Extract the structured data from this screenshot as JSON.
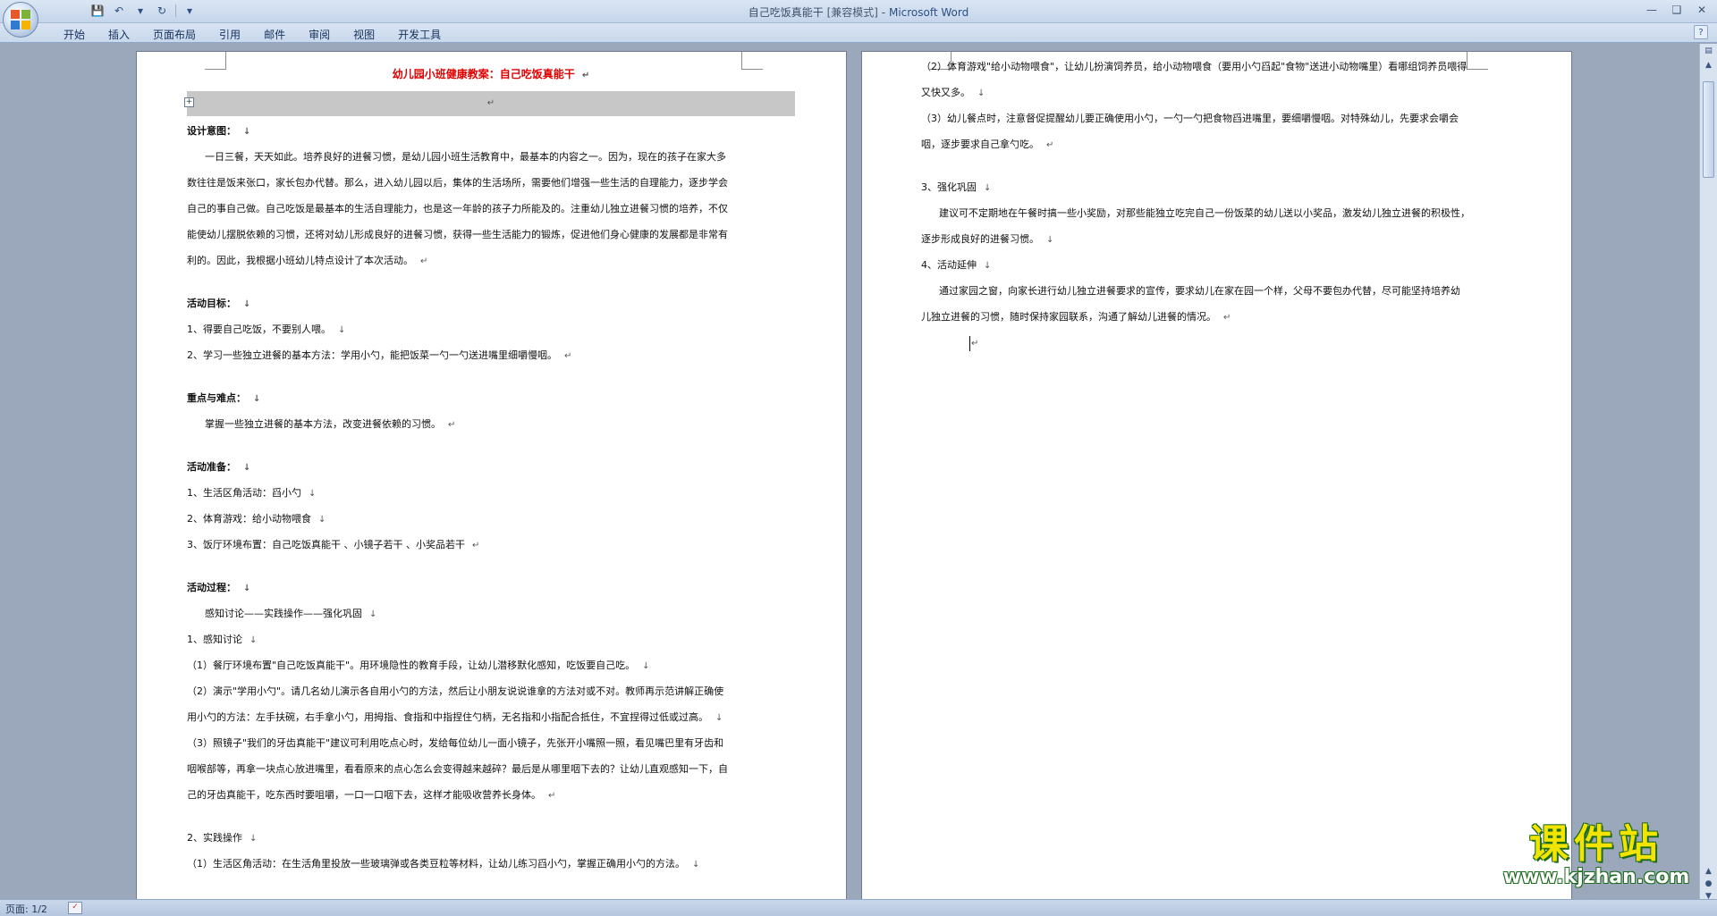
{
  "window": {
    "title": "自己吃饭真能干",
    "mode": "[兼容模式]",
    "separator": "-",
    "app": "Microsoft Word"
  },
  "quick_access": {
    "save_icon": "save-icon",
    "undo_icon": "undo-icon",
    "redo_icon": "redo-icon"
  },
  "ribbon_tabs": [
    "开始",
    "插入",
    "页面布局",
    "引用",
    "邮件",
    "审阅",
    "视图",
    "开发工具"
  ],
  "page1": {
    "title": "幼儿园小班健康教案：自己吃饭真能干",
    "paragraph_mark": "↵",
    "line_mark": "↓",
    "lines": {
      "h_design": "设计意图：",
      "p1_1": "一日三餐，天天如此。培养良好的进餐习惯，是幼儿园小班生活教育中，最基本的内容之一。因为，现在的孩子在家大多",
      "p1_2": "数往往是饭来张口，家长包办代替。那么，进入幼儿园以后，集体的生活场所，需要他们增强一些生活的自理能力，逐步学会",
      "p1_3": "自己的事自己做。自己吃饭是最基本的生活自理能力，也是这一年龄的孩子力所能及的。注重幼儿独立进餐习惯的培养，不仅",
      "p1_4": "能使幼儿摆脱依赖的习惯，还将对幼儿形成良好的进餐习惯，获得一些生活能力的锻炼，促进他们身心健康的发展都是非常有",
      "p1_5": "利的。因此，我根据小班幼儿特点设计了本次活动。",
      "h_goal": "活动目标：",
      "goal_1": "1、得要自己吃饭，不要别人喂。",
      "goal_2": "2、学习一些独立进餐的基本方法：学用小勺，能把饭菜一勺一勺送进嘴里细嚼慢咽。",
      "h_key": "重点与难点：",
      "key_1": "掌握一些独立进餐的基本方法，改变进餐依赖的习惯。",
      "h_prep": "活动准备：",
      "prep_1": "1、生活区角活动：舀小勺",
      "prep_2": "2、体育游戏：给小动物喂食",
      "prep_3": "3、饭厅环境布置：自己吃饭真能干 、小镜子若干 、小奖品若干",
      "h_process": "活动过程：",
      "proc_flow": "感知讨论——实践操作——强化巩固",
      "proc_1": "1、感知讨论",
      "proc_1_1": "（1）餐厅环境布置\"自己吃饭真能干\"。用环境隐性的教育手段，让幼儿潜移默化感知，吃饭要自己吃。",
      "proc_1_2a": "（2）演示\"学用小勺\"。请几名幼儿演示各自用小勺的方法，然后让小朋友说说谁拿的方法对或不对。教师再示范讲解正确使",
      "proc_1_2b": "用小勺的方法：左手扶碗，右手拿小勺，用拇指、食指和中指捏住勺柄，无名指和小指配合抵住，不宜捏得过低或过高。",
      "proc_1_3a": "（3）照镜子\"我们的牙齿真能干\"建议可利用吃点心时，发给每位幼儿一面小镜子，先张开小嘴照一照，看见嘴巴里有牙齿和",
      "proc_1_3b": "咽喉部等，再拿一块点心放进嘴里，看看原来的点心怎么会变得越来越碎？最后是从哪里咽下去的？让幼儿直观感知一下，自",
      "proc_1_3c": "己的牙齿真能干，吃东西时要咀嚼，一口一口咽下去，这样才能吸收营养长身体。",
      "proc_2": "2、实践操作",
      "proc_2_1": "（1）生活区角活动：在生活角里投放一些玻璃弹或各类豆粒等材料，让幼儿练习舀小勺，掌握正确用小勺的方法。"
    }
  },
  "page2": {
    "lines": {
      "p2_1a": "（2）体育游戏\"给小动物喂食\"，让幼儿扮演饲养员，给小动物喂食（要用小勺舀起\"食物\"送进小动物嘴里）看哪组饲养员喂得",
      "p2_1b": "又快又多。",
      "p2_2a": "（3）幼儿餐点时，注意督促提醒幼儿要正确使用小勺，一勺一勺把食物舀进嘴里，要细嚼慢咽。对特殊幼儿，先要求会嚼会",
      "p2_2b": "咽，逐步要求自己拿勺吃。",
      "h_3": "3、强化巩固",
      "p3_1": "建议可不定期地在午餐时搞一些小奖励，对那些能独立吃完自己一份饭菜的幼儿送以小奖品，激发幼儿独立进餐的积极性，",
      "p3_2": "逐步形成良好的进餐习惯。",
      "h_4": "4、活动延伸",
      "p4_1": "通过家园之窗，向家长进行幼儿独立进餐要求的宣传，要求幼儿在家在园一个样，父母不要包办代替，尽可能坚持培养幼",
      "p4_2": "儿独立进餐的习惯，随时保持家园联系，沟通了解幼儿进餐的情况。"
    }
  },
  "status": {
    "page_info": "页面: 1/2"
  },
  "watermark": {
    "title": "课件站",
    "url": "www.kjzhan.com"
  }
}
